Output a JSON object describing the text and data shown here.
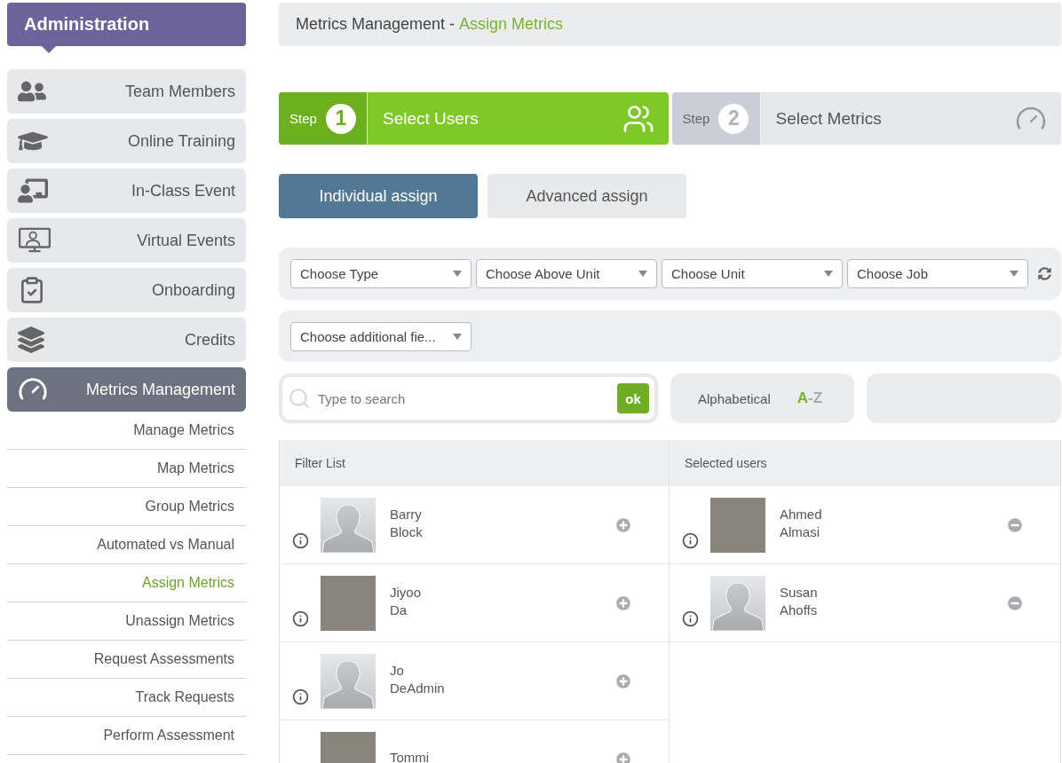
{
  "sidebar": {
    "title": "Administration",
    "items": [
      {
        "label": "Team Members",
        "selected": false
      },
      {
        "label": "Online Training",
        "selected": false
      },
      {
        "label": "In-Class Event",
        "selected": false
      },
      {
        "label": "Virtual Events",
        "selected": false
      },
      {
        "label": "Onboarding",
        "selected": false
      },
      {
        "label": "Credits",
        "selected": false
      },
      {
        "label": "Metrics Management",
        "selected": true,
        "children": [
          {
            "label": "Manage Metrics",
            "selected": false
          },
          {
            "label": "Map Metrics",
            "selected": false
          },
          {
            "label": "Group Metrics",
            "selected": false
          },
          {
            "label": "Automated vs Manual",
            "selected": false
          },
          {
            "label": "Assign Metrics",
            "selected": true
          },
          {
            "label": "Unassign Metrics",
            "selected": false
          },
          {
            "label": "Request Assessments",
            "selected": false
          },
          {
            "label": "Track Requests",
            "selected": false
          },
          {
            "label": "Perform Assessment",
            "selected": false
          }
        ]
      }
    ]
  },
  "breadcrumb": {
    "parent": "Metrics Management",
    "separator": "-",
    "current": "Assign Metrics"
  },
  "steps": [
    {
      "label": "Step",
      "number": "1",
      "title": "Select Users",
      "selected": true
    },
    {
      "label": "Step",
      "number": "2",
      "title": "Select Metrics",
      "selected": false
    }
  ],
  "assign_tabs": [
    {
      "label": "Individual assign",
      "selected": true
    },
    {
      "label": "Advanced assign",
      "selected": false
    }
  ],
  "filters": {
    "dropdowns": [
      {
        "placeholder": "Choose Type"
      },
      {
        "placeholder": "Choose Above Unit"
      },
      {
        "placeholder": "Choose Unit"
      },
      {
        "placeholder": "Choose Job"
      }
    ],
    "additional": {
      "placeholder": "Choose additional fie..."
    }
  },
  "search": {
    "placeholder": "Type to search",
    "button": "ok"
  },
  "sort": {
    "label": "Alphabetical",
    "order_first": "A",
    "order_rest": "-Z"
  },
  "filter_list": {
    "title": "Filter List",
    "users": [
      {
        "kind": "silhouette",
        "first_name": "Barry",
        "last_name": "Block"
      },
      {
        "kind": "photo",
        "first_name": "Jiyoo",
        "last_name": "Da"
      },
      {
        "kind": "silhouette",
        "first_name": "Jo",
        "last_name": "DeAdmin"
      },
      {
        "kind": "photo",
        "first_name": "Tommi"
      }
    ]
  },
  "selected_users": {
    "title": "Selected users",
    "users": [
      {
        "kind": "photo",
        "first_name": "Ahmed",
        "last_name": "Almasi"
      },
      {
        "kind": "silhouette",
        "first_name": "Susan",
        "last_name": "Ahoffs"
      }
    ]
  }
}
